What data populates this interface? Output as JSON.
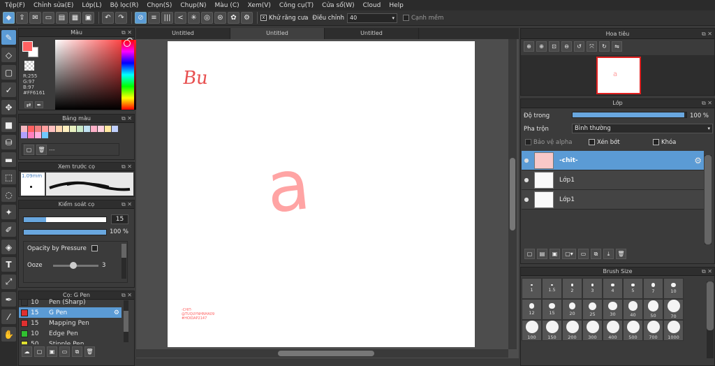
{
  "menu": [
    "Tệp(F)",
    "Chỉnh sửa(E)",
    "Lớp(L)",
    "Bộ lọc(R)",
    "Chọn(S)",
    "Chụp(N)",
    "Màu (C)",
    "Xem(V)",
    "Công cụ(T)",
    "Cửa sổ(W)",
    "Cloud",
    "Help"
  ],
  "toolbar": {
    "antialias_label": "Khử răng cưa",
    "adjust_label": "Điều chỉnh",
    "adjust_value": "40",
    "edge_label": "Cạnh mềm"
  },
  "color_panel": {
    "title": "Màu",
    "r": "R:255",
    "g": "G:97",
    "b": "B:97",
    "hex": "#FF6161",
    "accent": "#FF6161"
  },
  "palette_panel": {
    "title": "Bảng màu",
    "footer": "---",
    "colors": [
      "#f5b8c0",
      "#ff6161",
      "#f08080",
      "#ffa0a0",
      "#ffc0c0",
      "#ffd8b0",
      "#fff0c0",
      "#e8f0c0",
      "#c8e8c8",
      "#c0e0f0",
      "#ffb0c8",
      "#ffd0e0",
      "#ffe8a0",
      "#c0d0ff",
      "#b0a0ff",
      "#ff80c0",
      "#ffb0e0",
      "#70c8ff"
    ]
  },
  "preview_panel": {
    "title": "Xem trước cọ",
    "size": "1.09mm"
  },
  "brush_control": {
    "title": "Kiểm soát cọ",
    "size": "15",
    "opacity": "100 %",
    "opacity_pressure": "Opacity by Pressure",
    "ooze_label": "Ooze",
    "ooze_value": "3",
    "size_fill": 0.27,
    "opacity_fill": 1.0,
    "ooze_fill": 0.45
  },
  "brush_list": {
    "title": "Cọ: G Pen",
    "items": [
      {
        "size": "10",
        "name": "Pen (Sharp)",
        "color": "#333333",
        "selected": false
      },
      {
        "size": "15",
        "name": "G Pen",
        "color": "#e03030",
        "selected": true
      },
      {
        "size": "15",
        "name": "Mapping Pen",
        "color": "#e03030",
        "selected": false
      },
      {
        "size": "10",
        "name": "Edge Pen",
        "color": "#30c030",
        "selected": false
      },
      {
        "size": "50",
        "name": "Stipple Pen",
        "color": "#e0e030",
        "selected": false
      }
    ]
  },
  "tabs": [
    "Untitled",
    "Untitled",
    "Untitled"
  ],
  "canvas": {
    "text1": "Bu",
    "text2": "a",
    "signature": "-CHIT-\n@TUQUYNHNHA09\n#HOIDAP2147"
  },
  "navigator": {
    "title": "Hoa tiêu"
  },
  "layer_panel": {
    "title": "Lớp",
    "opacity_label": "Độ trong",
    "opacity_value": "100 %",
    "opacity_fill": 0.98,
    "blend_label": "Pha trộn",
    "blend_value": "Bình thường",
    "protect_alpha": "Bảo vệ alpha",
    "clipping": "Xén bớt",
    "lock": "Khóa",
    "layers": [
      {
        "name": "-chit-",
        "selected": true
      },
      {
        "name": "Lớp1",
        "selected": false
      },
      {
        "name": "Lớp1",
        "selected": false
      }
    ]
  },
  "brush_size": {
    "title": "Brush Size",
    "sizes": [
      "1",
      "1.5",
      "2",
      "3",
      "4",
      "5",
      "7",
      "10",
      "12",
      "15",
      "20",
      "25",
      "30",
      "40",
      "50",
      "70",
      "100",
      "150",
      "200",
      "300",
      "400",
      "500",
      "700",
      "1000"
    ]
  }
}
